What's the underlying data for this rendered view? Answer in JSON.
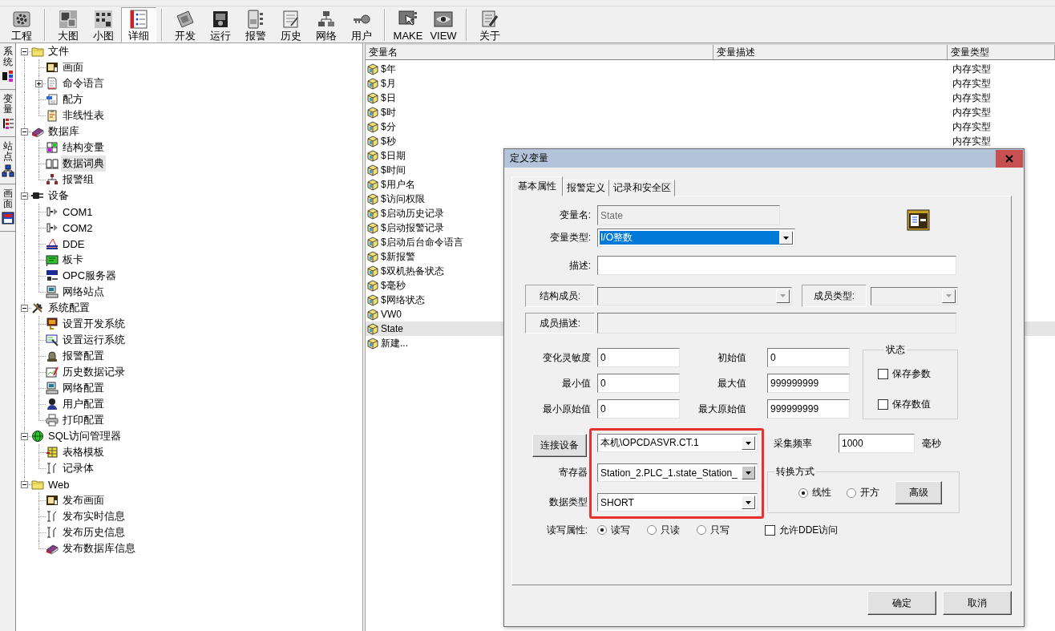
{
  "toolbar": {
    "groups": [
      {
        "buttons": [
          {
            "label": "工程",
            "selected": false
          }
        ]
      },
      {
        "buttons": [
          {
            "label": "大图",
            "selected": false
          },
          {
            "label": "小图",
            "selected": false
          },
          {
            "label": "详细",
            "selected": true
          }
        ]
      },
      {
        "buttons": [
          {
            "label": "开发",
            "selected": false
          },
          {
            "label": "运行",
            "selected": false
          },
          {
            "label": "报警",
            "selected": false
          },
          {
            "label": "历史",
            "selected": false
          },
          {
            "label": "网络",
            "selected": false
          },
          {
            "label": "用户",
            "selected": false
          }
        ]
      },
      {
        "buttons": [
          {
            "label": "MAKE",
            "selected": false
          },
          {
            "label": "VIEW",
            "selected": false
          }
        ]
      },
      {
        "buttons": [
          {
            "label": "关于",
            "selected": false
          }
        ]
      }
    ]
  },
  "side_tabs": [
    {
      "label": "系统"
    },
    {
      "label": "变量"
    },
    {
      "label": "站点"
    },
    {
      "label": "画面"
    }
  ],
  "tree": [
    {
      "label": "文件",
      "expanded": true,
      "selected": false,
      "children": [
        {
          "label": "画面",
          "selected": false
        },
        {
          "label": "命令语言",
          "expanded": false,
          "selected": false
        },
        {
          "label": "配方",
          "selected": false
        },
        {
          "label": "非线性表",
          "selected": false
        }
      ]
    },
    {
      "label": "数据库",
      "expanded": true,
      "selected": false,
      "children": [
        {
          "label": "结构变量",
          "selected": false
        },
        {
          "label": "数据词典",
          "selected": true
        },
        {
          "label": "报警组",
          "selected": false
        }
      ]
    },
    {
      "label": "设备",
      "expanded": true,
      "selected": false,
      "children": [
        {
          "label": "COM1",
          "selected": false
        },
        {
          "label": "COM2",
          "selected": false
        },
        {
          "label": "DDE",
          "selected": false
        },
        {
          "label": "板卡",
          "selected": false
        },
        {
          "label": "OPC服务器",
          "selected": false
        },
        {
          "label": "网络站点",
          "selected": false
        }
      ]
    },
    {
      "label": "系统配置",
      "expanded": true,
      "selected": false,
      "children": [
        {
          "label": "设置开发系统",
          "selected": false
        },
        {
          "label": "设置运行系统",
          "selected": false
        },
        {
          "label": "报警配置",
          "selected": false
        },
        {
          "label": "历史数据记录",
          "selected": false
        },
        {
          "label": "网络配置",
          "selected": false
        },
        {
          "label": "用户配置",
          "selected": false
        },
        {
          "label": "打印配置",
          "selected": false
        }
      ]
    },
    {
      "label": "SQL访问管理器",
      "expanded": true,
      "selected": false,
      "children": [
        {
          "label": "表格模板",
          "selected": false
        },
        {
          "label": "记录体",
          "selected": false
        }
      ]
    },
    {
      "label": "Web",
      "expanded": true,
      "selected": false,
      "children": [
        {
          "label": "发布画面",
          "selected": false
        },
        {
          "label": "发布实时信息",
          "selected": false
        },
        {
          "label": "发布历史信息",
          "selected": false
        },
        {
          "label": "发布数据库信息",
          "selected": false
        }
      ]
    }
  ],
  "variable_list": {
    "columns": [
      "变量名",
      "变量描述",
      "变量类型"
    ],
    "rows": [
      {
        "name": "$年",
        "type": "内存实型",
        "selected": false
      },
      {
        "name": "$月",
        "type": "内存实型",
        "selected": false
      },
      {
        "name": "$日",
        "type": "内存实型",
        "selected": false
      },
      {
        "name": "$时",
        "type": "内存实型",
        "selected": false
      },
      {
        "name": "$分",
        "type": "内存实型",
        "selected": false
      },
      {
        "name": "$秒",
        "type": "内存实型",
        "selected": false
      },
      {
        "name": "$日期",
        "selected": false
      },
      {
        "name": "$时间",
        "selected": false
      },
      {
        "name": "$用户名",
        "selected": false
      },
      {
        "name": "$访问权限",
        "selected": false
      },
      {
        "name": "$启动历史记录",
        "selected": false
      },
      {
        "name": "$启动报警记录",
        "selected": false
      },
      {
        "name": "$启动后台命令语言",
        "selected": false
      },
      {
        "name": "$新报警",
        "selected": false
      },
      {
        "name": "$双机热备状态",
        "selected": false
      },
      {
        "name": "$毫秒",
        "selected": false
      },
      {
        "name": "$网络状态",
        "selected": false
      },
      {
        "name": "VW0",
        "selected": false
      },
      {
        "name": "State",
        "selected": true
      },
      {
        "name": "新建...",
        "selected": false
      }
    ]
  },
  "dialog": {
    "title": "定义变量",
    "tabs": [
      {
        "label": "基本属性",
        "selected": true
      },
      {
        "label": "报警定义",
        "selected": false
      },
      {
        "label": "记录和安全区",
        "selected": false
      }
    ],
    "name_field": {
      "label": "变量名:",
      "value": "State",
      "disabled": true
    },
    "type_field": {
      "label": "变量类型:",
      "value": "I/O整数",
      "focused": true
    },
    "description_field": {
      "label": "描述:"
    },
    "member_field": {
      "label": "结构成员:",
      "disabled": true
    },
    "member_type_field": {
      "label": "成员类型:",
      "disabled": true
    },
    "member_description_field": {
      "label": "成员描述:",
      "disabled": true
    },
    "value_fields": [
      {
        "label": "变化灵敏度",
        "value": "0"
      },
      {
        "label": "初始值",
        "value": "0"
      },
      {
        "label": "最小值",
        "value": "0"
      },
      {
        "label": "最大值",
        "value": "999999999"
      },
      {
        "label": "最小原始值",
        "value": "0"
      },
      {
        "label": "最大原始值",
        "value": "999999999"
      }
    ],
    "status_group": {
      "title": "状态",
      "options": [
        {
          "label": "保存参数",
          "checked": false
        },
        {
          "label": "保存数值",
          "checked": false
        }
      ]
    },
    "device_button": "连接设备",
    "device_field": {
      "value": "本机\\OPCDASVR.CT.1"
    },
    "register_field": {
      "label": "寄存器",
      "value": "Station_2.PLC_1.state_Station_"
    },
    "data_type_field": {
      "label": "数据类型",
      "value": "SHORT"
    },
    "highlight_frame": true,
    "sample_rate": {
      "label": "采集频率",
      "value": "1000",
      "unit": "毫秒"
    },
    "conversion_group": {
      "title": "转换方式",
      "options": [
        {
          "label": "线性",
          "selected": true
        },
        {
          "label": "开方",
          "selected": false
        }
      ],
      "button": "高级"
    },
    "access": {
      "label": "读写属性:",
      "options": [
        {
          "label": "读写",
          "selected": true
        },
        {
          "label": "只读",
          "selected": false
        },
        {
          "label": "只写",
          "selected": false
        }
      ]
    },
    "dde_checkbox": {
      "label": "允许DDE访问",
      "checked": false
    },
    "buttons": [
      {
        "label": "确定"
      },
      {
        "label": "取消"
      }
    ]
  }
}
